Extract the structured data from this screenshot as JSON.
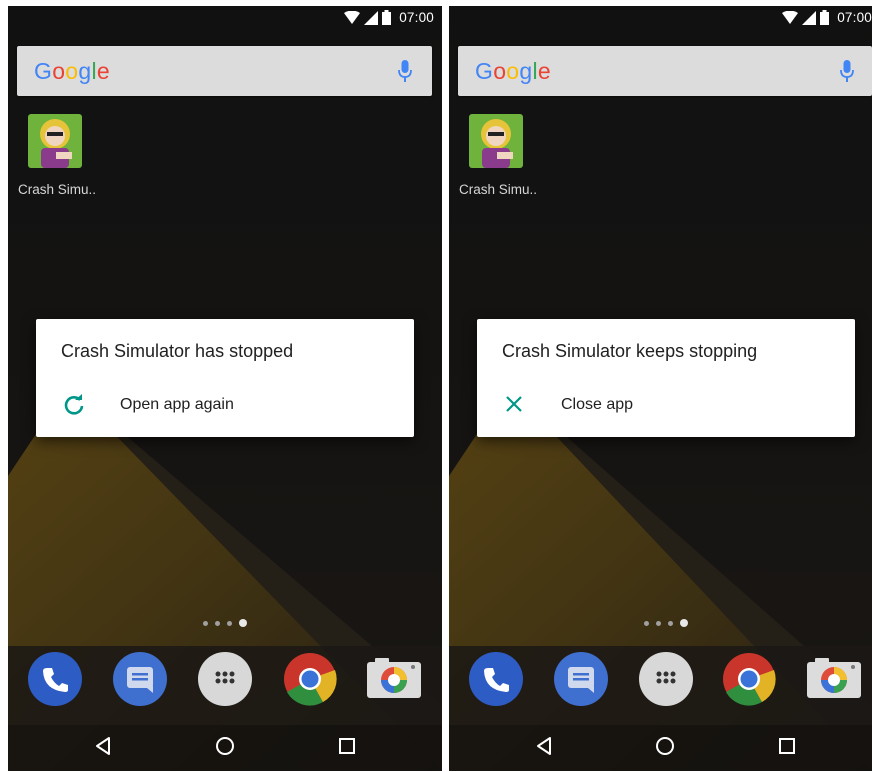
{
  "screens": [
    {
      "status": {
        "time": "07:00"
      },
      "search": {
        "logo": "Google",
        "mic_icon": "mic-icon"
      },
      "desktop_app": {
        "label": "Crash Simu..",
        "icon": "crash-simulator-app-icon"
      },
      "dialog": {
        "title": "Crash Simulator has stopped",
        "action_label": "Open app again",
        "action_icon": "refresh-icon"
      },
      "dock": [
        "phone-icon",
        "messages-icon",
        "app-drawer-icon",
        "chrome-icon",
        "camera-icon"
      ],
      "navbar": [
        "back-icon",
        "home-icon",
        "recents-icon"
      ]
    },
    {
      "status": {
        "time": "07:00"
      },
      "search": {
        "logo": "Google",
        "mic_icon": "mic-icon"
      },
      "desktop_app": {
        "label": "Crash Simu..",
        "icon": "crash-simulator-app-icon"
      },
      "dialog": {
        "title": "Crash Simulator keeps stopping",
        "action_label": "Close app",
        "action_icon": "close-icon"
      },
      "dock": [
        "phone-icon",
        "messages-icon",
        "app-drawer-icon",
        "chrome-icon",
        "camera-icon"
      ],
      "navbar": [
        "back-icon",
        "home-icon",
        "recents-icon"
      ]
    }
  ],
  "colors": {
    "accent_teal": "#009688",
    "dialog_bg": "#ffffff",
    "phone_blue": "#3267d6",
    "messages_blue": "#4a7bd6"
  }
}
